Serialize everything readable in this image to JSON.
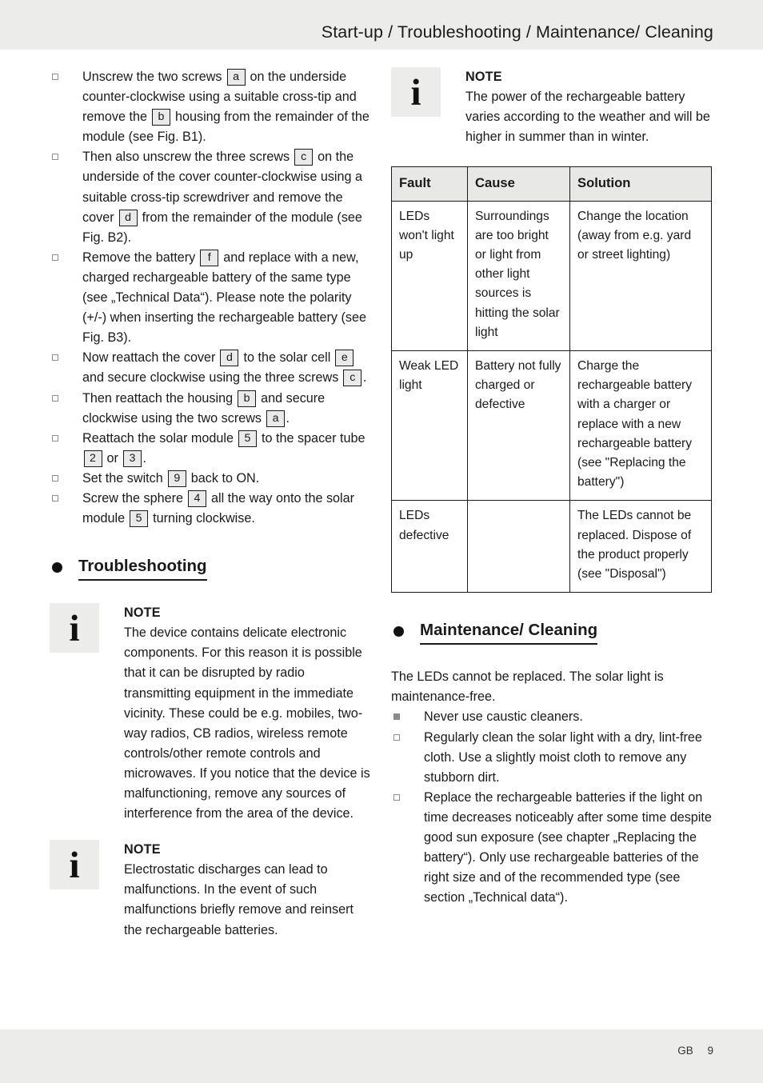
{
  "header": {
    "title": "Start-up / Troubleshooting / Maintenance/ Cleaning"
  },
  "footer": {
    "locale": "GB",
    "page_number": "9"
  },
  "icons": {
    "info_glyph": "i",
    "note_label": "NOTE"
  },
  "left_column": {
    "steps": [
      {
        "marker": "hollow-square",
        "segments": [
          {
            "t": "Unscrew the two screws "
          },
          {
            "ref": "a"
          },
          {
            "t": " on the underside counter-clockwise using a suitable cross-tip and remove the "
          },
          {
            "ref": "b"
          },
          {
            "t": " housing from the remainder of the module (see Fig. B1)."
          }
        ]
      },
      {
        "marker": "hollow-square",
        "segments": [
          {
            "t": "Then also unscrew the three screws "
          },
          {
            "ref": "c"
          },
          {
            "t": " on the underside of the cover counter-clockwise using a suitable cross-tip screwdriver and remove the cover "
          },
          {
            "ref": "d"
          },
          {
            "t": " from the remainder of the module (see Fig. B2)."
          }
        ]
      },
      {
        "marker": "hollow-square",
        "segments": [
          {
            "t": "Remove the battery "
          },
          {
            "ref": "f"
          },
          {
            "t": " and replace with a new, charged rechargeable battery of the same type (see „Technical Data“). Please note the polarity (+/-) when inserting the rechargeable battery (see Fig. B3)."
          }
        ]
      },
      {
        "marker": "hollow-square",
        "segments": [
          {
            "t": "Now reattach the cover "
          },
          {
            "ref": "d"
          },
          {
            "t": " to the solar cell "
          },
          {
            "ref": "e"
          },
          {
            "t": " and secure clockwise using the three screws "
          },
          {
            "ref": "c"
          },
          {
            "t": "."
          }
        ]
      },
      {
        "marker": "hollow-square",
        "segments": [
          {
            "t": "Then reattach the housing "
          },
          {
            "ref": "b"
          },
          {
            "t": " and secure clockwise using the two screws "
          },
          {
            "ref": "a"
          },
          {
            "t": "."
          }
        ]
      },
      {
        "marker": "hollow-square",
        "segments": [
          {
            "t": "Reattach the solar module "
          },
          {
            "ref": "5"
          },
          {
            "t": " to the spacer tube "
          },
          {
            "ref": "2"
          },
          {
            "t": " or "
          },
          {
            "ref": "3"
          },
          {
            "t": "."
          }
        ]
      },
      {
        "marker": "hollow-square",
        "segments": [
          {
            "t": "Set the switch "
          },
          {
            "ref": "9"
          },
          {
            "t": " back to ON."
          }
        ]
      },
      {
        "marker": "hollow-square",
        "segments": [
          {
            "t": "Screw the sphere "
          },
          {
            "ref": "4"
          },
          {
            "t": " all the way onto the solar module "
          },
          {
            "ref": "5"
          },
          {
            "t": " turning clockwise."
          }
        ]
      }
    ],
    "troubleshooting_heading": "Troubleshooting",
    "note_radio": {
      "title": "NOTE",
      "body": "The device contains delicate electronic components. For this reason it is possible that it can be disrupted by radio transmitting equipment in the immediate vicinity. These could be e.g. mobiles, two-way radios, CB radios, wireless remote controls/other remote controls and microwaves. If you notice that the device is malfunctioning, remove any sources of interference from the area of the device."
    },
    "note_esd": {
      "title": "NOTE",
      "body": "Electrostatic discharges can lead to malfunctions. In the event of such malfunctions briefly remove and reinsert the rechargeable batteries."
    }
  },
  "right_column": {
    "note_power": {
      "title": "NOTE",
      "body": "The power of the rechargeable battery varies according to the weather and will be higher in summer than in winter."
    },
    "fault_table": {
      "columns": [
        "Fault",
        "Cause",
        "Solution"
      ],
      "rows": [
        {
          "fault": "LEDs won't light up",
          "cause": "Surroundings are too bright or light from other light sources is hitting the solar light",
          "solution": "Change the location (away from e.g. yard or street lighting)"
        },
        {
          "fault": "Weak LED light",
          "cause": "Battery not fully charged or defective",
          "solution": "Charge the rechargeable battery with a charger or replace with a new rechargeable battery (see \"Replacing the battery\")"
        },
        {
          "fault": "LEDs defective",
          "cause": "",
          "solution": "The LEDs cannot be replaced. Dispose of the product properly (see \"Disposal\")"
        }
      ]
    },
    "maintenance_heading": "Maintenance/ Cleaning",
    "maintenance_intro": "The LEDs cannot be replaced. The solar light is maintenance-free.",
    "maintenance_bullets": [
      {
        "marker": "filled-square",
        "text": "Never use caustic cleaners."
      },
      {
        "marker": "hollow-square",
        "text": "Regularly clean the solar light with a dry, lint-free cloth. Use a slightly moist cloth to remove any stubborn dirt."
      },
      {
        "marker": "hollow-square",
        "text": "Replace the rechargeable batteries if the light on time decreases noticeably after some time despite good sun exposure (see chapter „Replacing the battery“). Only use rechargeable batteries of the right size and of the recommended type (see section „Technical data“)."
      }
    ]
  }
}
